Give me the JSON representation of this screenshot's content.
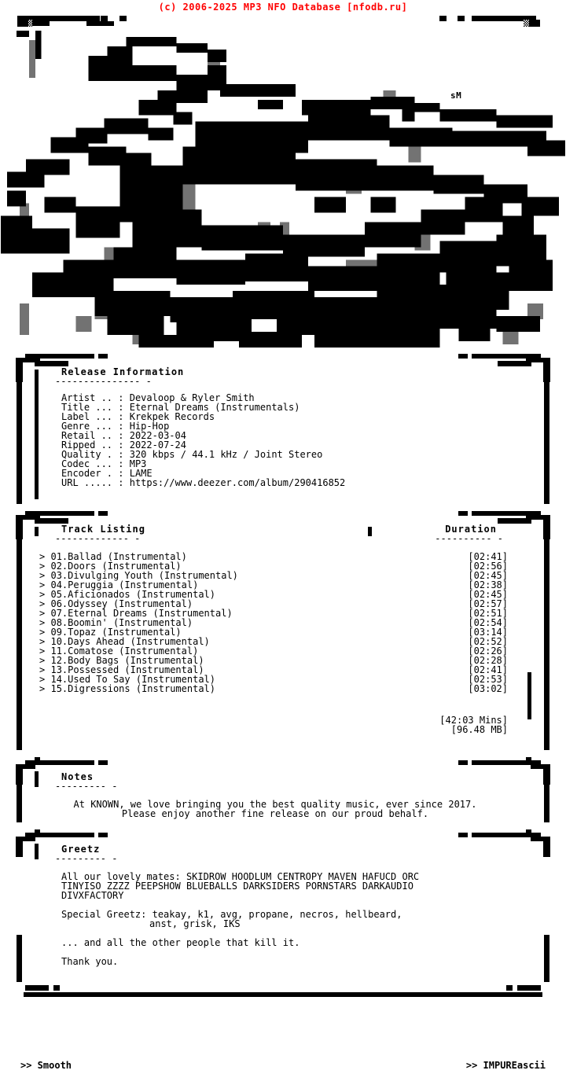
{
  "header": {
    "copyright": "(c) 2006-2025 MP3 NFO Database [nfodb.ru]",
    "color": "#ff0000"
  },
  "logo": {
    "group": "KNOWN",
    "artist_signature": "sM",
    "style": "ascii-graffiti"
  },
  "release_information": {
    "title": "Release Information",
    "rule": "--------------- -",
    "fields": [
      {
        "label": "Artist .. :",
        "value": "Devaloop & Ryler Smith"
      },
      {
        "label": "Title ... :",
        "value": "Eternal Dreams (Instrumentals)"
      },
      {
        "label": "Label ... :",
        "value": "Krekpek Records"
      },
      {
        "label": "Genre ... :",
        "value": "Hip-Hop"
      },
      {
        "label": "Retail .. :",
        "value": "2022-03-04"
      },
      {
        "label": "Ripped .. :",
        "value": "2022-07-24"
      },
      {
        "label": "Quality . :",
        "value": "320 kbps / 44.1 kHz / Joint Stereo"
      },
      {
        "label": "Codec ... :",
        "value": "MP3"
      },
      {
        "label": "Encoder . :",
        "value": "LAME"
      },
      {
        "label": "URL ..... :",
        "value": "https://www.deezer.com/album/290416852"
      }
    ]
  },
  "track_listing": {
    "title": "Track Listing",
    "rule": "------------- -",
    "duration_title": "Duration",
    "duration_rule": "---------- -",
    "bullet": ">",
    "tracks": [
      {
        "num": "01.",
        "name": "Ballad (Instrumental)",
        "duration": "[02:41]"
      },
      {
        "num": "02.",
        "name": "Doors (Instrumental)",
        "duration": "[02:56]"
      },
      {
        "num": "03.",
        "name": "Divulging Youth (Instrumental)",
        "duration": "[02:45]"
      },
      {
        "num": "04.",
        "name": "Peruggia (Instrumental)",
        "duration": "[02:38]"
      },
      {
        "num": "05.",
        "name": "Aficionados (Instrumental)",
        "duration": "[02:45]"
      },
      {
        "num": "06.",
        "name": "Odyssey (Instrumental)",
        "duration": "[02:57]"
      },
      {
        "num": "07.",
        "name": "Eternal Dreams (Instrumental)",
        "duration": "[02:51]"
      },
      {
        "num": "08.",
        "name": "Boomin' (Instrumental)",
        "duration": "[02:54]"
      },
      {
        "num": "09.",
        "name": "Topaz (Instrumental)",
        "duration": "[03:14]"
      },
      {
        "num": "10.",
        "name": "Days Ahead (Instrumental)",
        "duration": "[02:52]"
      },
      {
        "num": "11.",
        "name": "Comatose (Instrumental)",
        "duration": "[02:26]"
      },
      {
        "num": "12.",
        "name": "Body Bags (Instrumental)",
        "duration": "[02:28]"
      },
      {
        "num": "13.",
        "name": "Possessed (Instrumental)",
        "duration": "[02:41]"
      },
      {
        "num": "14.",
        "name": "Used To Say (Instrumental)",
        "duration": "[02:53]"
      },
      {
        "num": "15.",
        "name": "Digressions (Instrumental)",
        "duration": "[03:02]"
      }
    ],
    "total_time": "[42:03 Mins]",
    "total_size": "[96.48 MB]"
  },
  "notes": {
    "title": "Notes",
    "rule": "--------- -",
    "line1": "At KNOWN, we love bringing you the best quality music, ever since 2017.",
    "line2": "Please enjoy another fine release on our proud behalf."
  },
  "greetz": {
    "title": "Greetz",
    "rule": "--------- -",
    "mates_label": "All our lovely mates: SKIDROW HOODLUM CENTROPY MAVEN HAFUCD ORC",
    "mates_line2": "TINYISO ZZZZ PEEPSHOW BLUEBALLS DARKSIDERS PORNSTARS DARKAUDIO",
    "mates_line3": "DIVXFACTORY",
    "special_line1": "Special Greetz: teakay, k1, avg, propane, necros, hellbeard,",
    "special_line2": "anst, grisk, IKS",
    "others": "... and all the other people that kill it.",
    "thanks": "Thank you."
  },
  "footer": {
    "left": ">> Smooth",
    "right": ">> IMPUREascii"
  }
}
